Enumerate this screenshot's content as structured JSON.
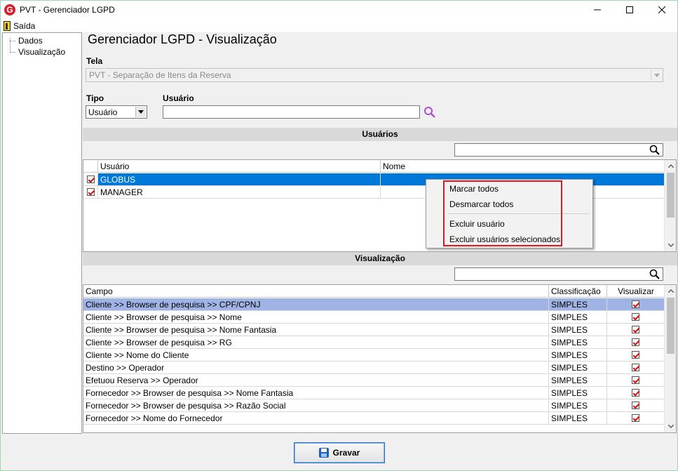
{
  "window": {
    "title": "PVT - Gerenciador LGPD",
    "logo_letter": "G",
    "accent_color": "#0078d7",
    "highlight_color": "#e8141c"
  },
  "menu": {
    "exit_label": "Saída"
  },
  "tree": {
    "items": [
      "Dados",
      "Visualização"
    ]
  },
  "main": {
    "title": "Gerenciador LGPD - Visualização",
    "tela_label": "Tela",
    "tela_value": "PVT - Separação de Itens da Reserva",
    "tipo_label": "Tipo",
    "tipo_value": "Usuário",
    "usuario_label": "Usuário",
    "usuario_value": ""
  },
  "users_section": {
    "title": "Usuários",
    "filter_value": "",
    "columns": [
      "Usuário",
      "Nome"
    ],
    "rows": [
      {
        "usuario": "GLOBUS",
        "nome": "",
        "checked": true,
        "selected": true
      },
      {
        "usuario": "MANAGER",
        "nome": "",
        "checked": true,
        "selected": false
      }
    ]
  },
  "context_menu": {
    "items": [
      "Marcar todos",
      "Desmarcar todos",
      "Excluir usuário",
      "Excluir usuários selecionados"
    ]
  },
  "view_section": {
    "title": "Visualização",
    "filter_value": "",
    "columns": [
      "Campo",
      "Classificação",
      "Visualizar"
    ],
    "rows": [
      {
        "campo": "Cliente >> Browser de pesquisa >> CPF/CPNJ",
        "classificacao": "SIMPLES",
        "visualizar": true
      },
      {
        "campo": "Cliente >> Browser de pesquisa >> Nome",
        "classificacao": "SIMPLES",
        "visualizar": true
      },
      {
        "campo": "Cliente >> Browser de pesquisa >> Nome Fantasia",
        "classificacao": "SIMPLES",
        "visualizar": true
      },
      {
        "campo": "Cliente >> Browser de pesquisa >> RG",
        "classificacao": "SIMPLES",
        "visualizar": true
      },
      {
        "campo": "Cliente >> Nome do Cliente",
        "classificacao": "SIMPLES",
        "visualizar": true
      },
      {
        "campo": "Destino >> Operador",
        "classificacao": "SIMPLES",
        "visualizar": true
      },
      {
        "campo": "Efetuou Reserva >> Operador",
        "classificacao": "SIMPLES",
        "visualizar": true
      },
      {
        "campo": "Fornecedor >> Browser de pesquisa >> Nome Fantasia",
        "classificacao": "SIMPLES",
        "visualizar": true
      },
      {
        "campo": "Fornecedor >> Browser de pesquisa >> Razão Social",
        "classificacao": "SIMPLES",
        "visualizar": true
      },
      {
        "campo": "Fornecedor >> Nome do Fornecedor",
        "classificacao": "SIMPLES",
        "visualizar": true
      }
    ]
  },
  "footer": {
    "save_label": "Gravar"
  }
}
